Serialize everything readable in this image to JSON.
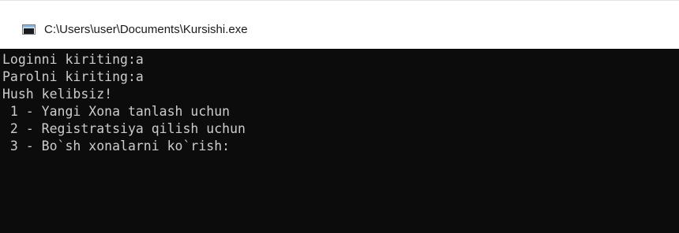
{
  "window": {
    "title": "C:\\Users\\user\\Documents\\Kursishi.exe",
    "icon": "console-app-icon"
  },
  "console": {
    "colors": {
      "background": "#0c0c0c",
      "text": "#cccccc"
    },
    "lines": [
      "Loginni kiriting:a",
      "Parolni kiriting:a",
      "Hush kelibsiz!",
      " 1 - Yangi Xona tanlash uchun",
      " 2 - Registratsiya qilish uchun",
      " 3 - Bo`sh xonalarni ko`rish:"
    ]
  }
}
